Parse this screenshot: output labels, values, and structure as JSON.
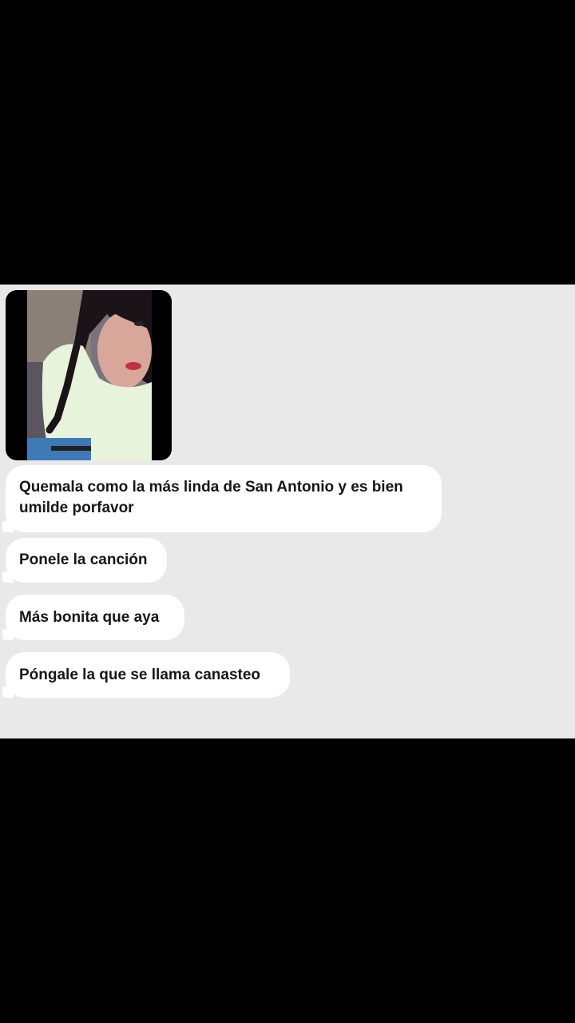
{
  "chat": {
    "photo_alt": "Foto de perfil enviada",
    "messages": [
      {
        "text": "Quemala como la más linda de San Antonio y es bien umilde porfavor"
      },
      {
        "text": "Ponele la canción"
      },
      {
        "text": "Más bonita que aya"
      },
      {
        "text": "Póngale la que se llama canasteo"
      }
    ]
  },
  "colors": {
    "background": "#e9e9e9",
    "bubble": "#ffffff",
    "text": "#161616",
    "frame": "#000000"
  }
}
